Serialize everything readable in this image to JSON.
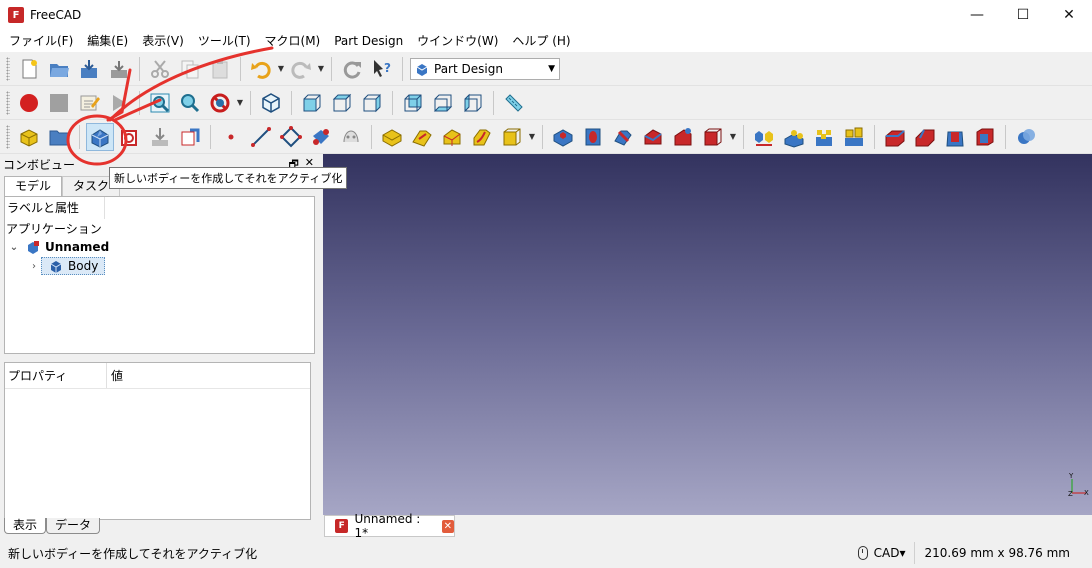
{
  "window": {
    "app_title": "FreeCAD",
    "logo_text": "F",
    "minimize": "—",
    "maximize": "☐",
    "close": "✕"
  },
  "menu": [
    "ファイル(F)",
    "編集(E)",
    "表示(V)",
    "ツール(T)",
    "マクロ(M)",
    "Part Design",
    "ウインドウ(W)",
    "ヘルプ (H)"
  ],
  "workbench_selector": {
    "value": "Part Design"
  },
  "combo_view": {
    "title": "コンボビュー",
    "tabs": [
      "モデル",
      "タスク"
    ],
    "tree_header": "ラベルと属性",
    "application_label": "アプリケーション",
    "document": "Unnamed",
    "body": "Body",
    "properties_header": {
      "property": "プロパティ",
      "value": "値"
    },
    "bottom_tabs": [
      "表示",
      "データ"
    ]
  },
  "tooltip": "新しいボディーを作成してそれをアクティブ化",
  "doc_tab": {
    "label": "Unnamed : 1*"
  },
  "axis": {
    "y": "Y",
    "z": "Z",
    "x": "X"
  },
  "statusbar": {
    "message": "新しいボディーを作成してそれをアクティブ化",
    "nav_style": "CAD▾",
    "dimensions": "210.69 mm x 98.76 mm"
  },
  "colors": {
    "view_top": "#33335f",
    "view_bottom": "#a6a6c5",
    "annotation": "#e5322d",
    "part_blue": "#3a76c4",
    "part_red": "#c8282a",
    "part_yellow": "#e8c21a"
  }
}
